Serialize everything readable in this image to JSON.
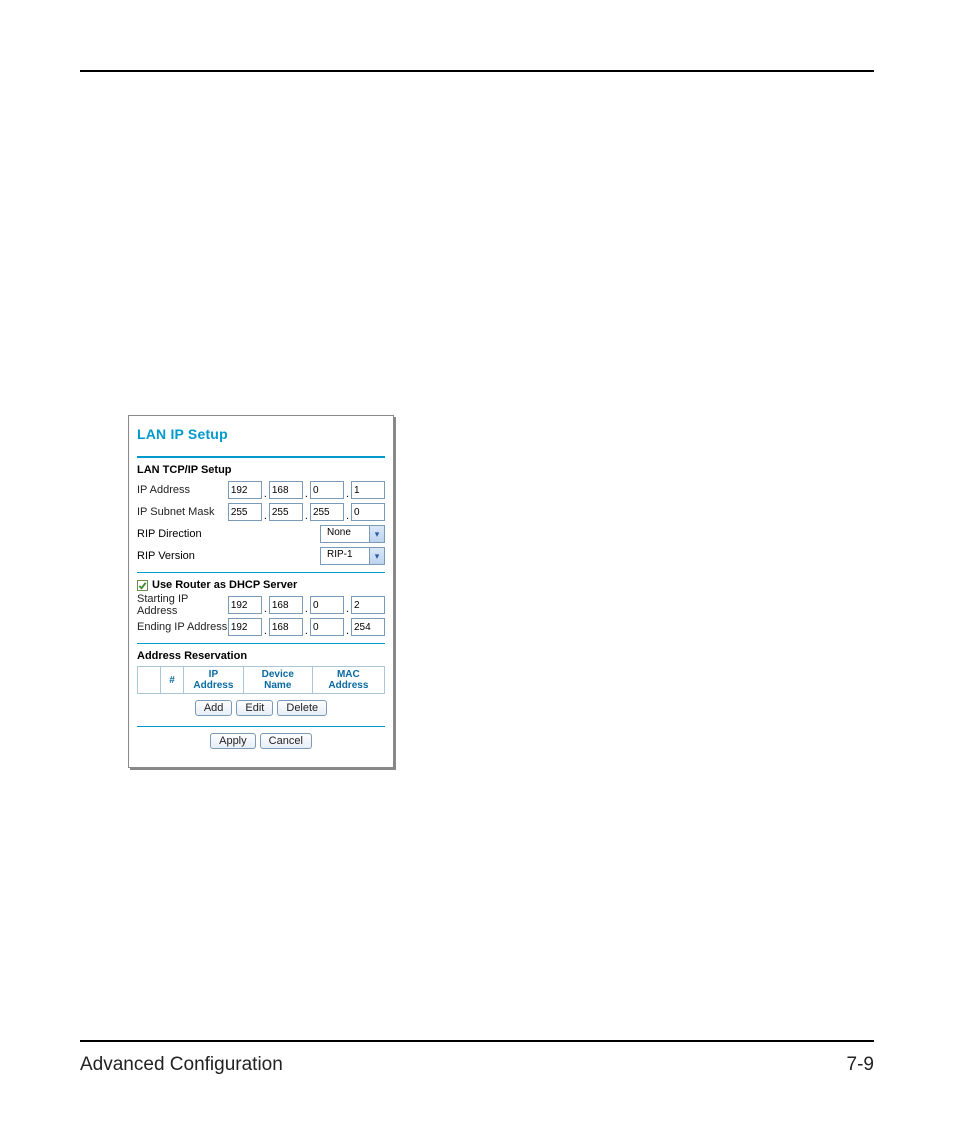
{
  "footer": {
    "left": "Advanced Configuration",
    "right": "7-9"
  },
  "panel": {
    "title": "LAN IP Setup",
    "tcp_section_title": "LAN TCP/IP Setup",
    "ip_label": "IP Address",
    "ip": [
      "192",
      "168",
      "0",
      "1"
    ],
    "mask_label": "IP Subnet Mask",
    "mask": [
      "255",
      "255",
      "255",
      "0"
    ],
    "rip_dir_label": "RIP Direction",
    "rip_dir_value": "None",
    "rip_ver_label": "RIP Version",
    "rip_ver_value": "RIP-1",
    "dhcp_checkbox_label": "Use Router as DHCP Server",
    "start_ip_label": "Starting IP Address",
    "start_ip": [
      "192",
      "168",
      "0",
      "2"
    ],
    "end_ip_label": "Ending IP Address",
    "end_ip": [
      "192",
      "168",
      "0",
      "254"
    ],
    "reservation_title": "Address Reservation",
    "reservation_headers": {
      "num": "#",
      "ip": "IP Address",
      "dev": "Device Name",
      "mac": "MAC Address"
    },
    "buttons": {
      "add": "Add",
      "edit": "Edit",
      "delete": "Delete",
      "apply": "Apply",
      "cancel": "Cancel"
    }
  }
}
